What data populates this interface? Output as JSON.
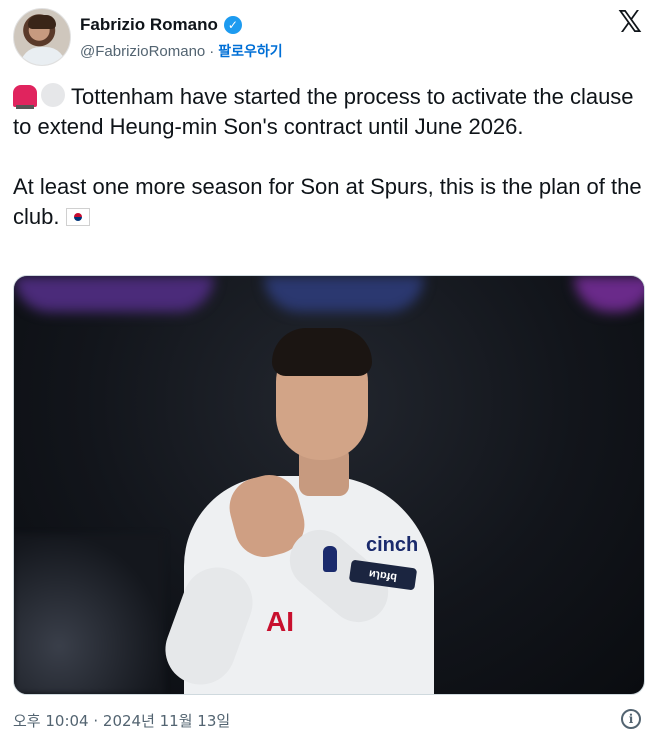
{
  "author": {
    "name": "Fabrizio Romano",
    "handle": "@FabrizioRomano",
    "separator": "·",
    "follow_label": "팔로우하기",
    "verified_icon": "verified-badge-icon"
  },
  "platform_icon": "x-logo-icon",
  "tweet": {
    "line1_emoji": [
      "siren-icon",
      "white-circle-icon"
    ],
    "paragraph1": "Tottenham have started the process to activate the clause to extend Heung-min Son's contract until June 2026.",
    "paragraph2": "At least one more season for Son at Spurs, this is the plan of the club.",
    "paragraph2_emoji": "south-korea-flag-icon"
  },
  "photo": {
    "sponsor_text": "cinch",
    "armband_text": "ᴎɿɒɟq"
  },
  "footer": {
    "timestamp": "오후 10:04 · 2024년 11월 13일",
    "info_icon": "info-icon"
  },
  "colors": {
    "text": "#0f1419",
    "secondary": "#536471",
    "link": "#006fd6",
    "verified": "#1d9bf0"
  }
}
